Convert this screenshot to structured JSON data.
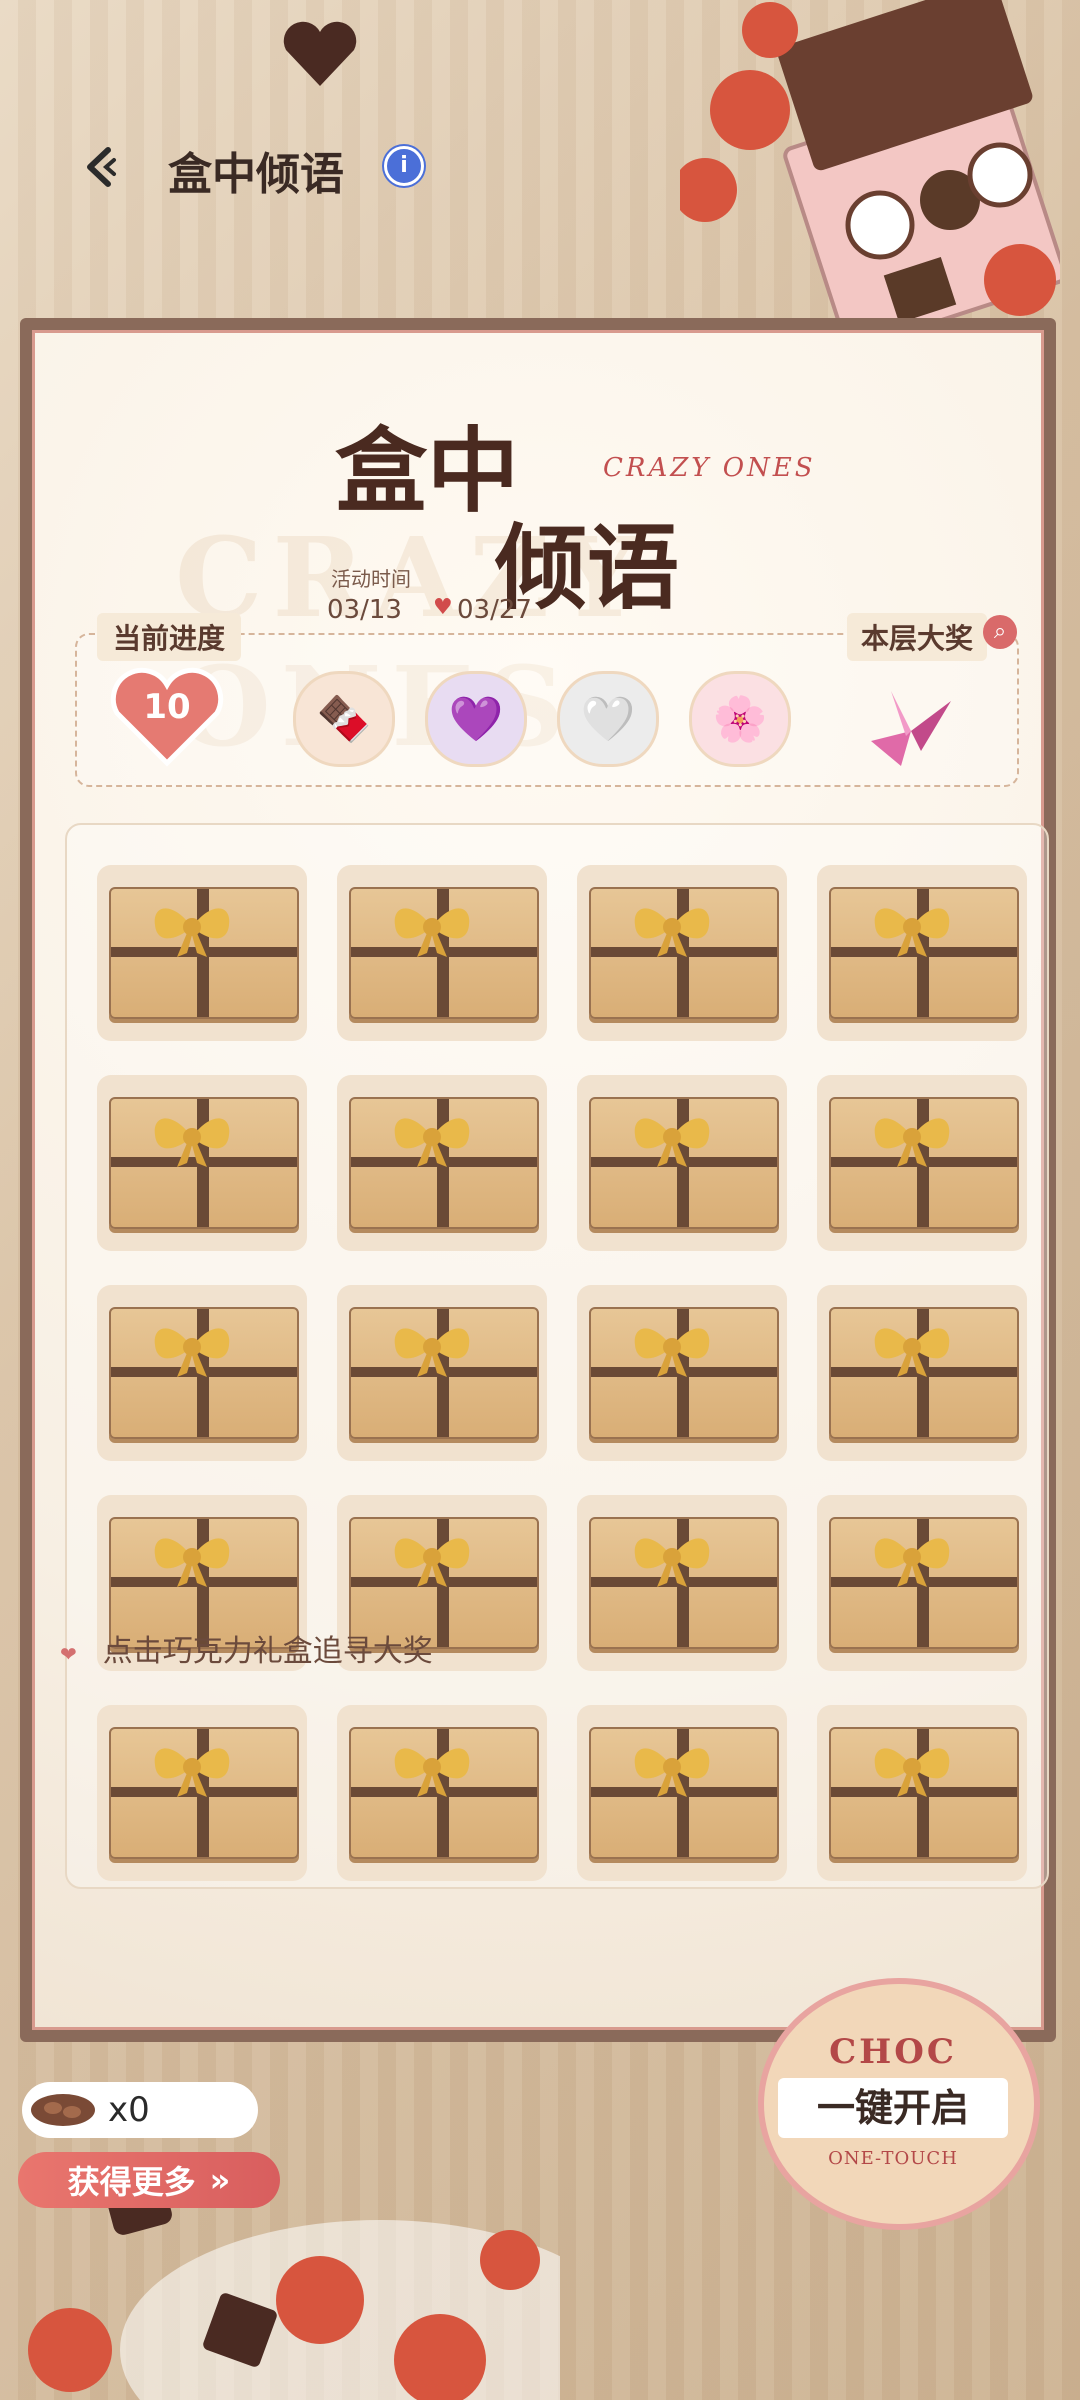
{
  "header": {
    "title": "盒中倾语",
    "info_label": "i"
  },
  "hero": {
    "title_line1": "盒中",
    "title_line2": "倾语",
    "subtitle": "CRAZY ONES",
    "watermark": "CRAZY ONES",
    "event_time_label": "活动时间",
    "event_start": "03/13",
    "event_end": "03/27"
  },
  "progress": {
    "label": "当前进度",
    "value": "10",
    "avatars": [
      "🍫",
      "💜",
      "🤍",
      "🌸"
    ],
    "prize_label": "本层大奖"
  },
  "grid": {
    "rows": 5,
    "cols": 4,
    "total_boxes": 20
  },
  "hint": "点击巧克力礼盒追寻大奖",
  "inventory": {
    "count": "x0",
    "get_more_label": "获得更多"
  },
  "one_touch": {
    "top": "CHOC",
    "main": "一键开启",
    "bottom": "ONE-TOUCH"
  },
  "colors": {
    "accent_red": "#d85e5e",
    "frame_brown": "#8a6a5a",
    "info_blue": "#4b6fd8"
  }
}
